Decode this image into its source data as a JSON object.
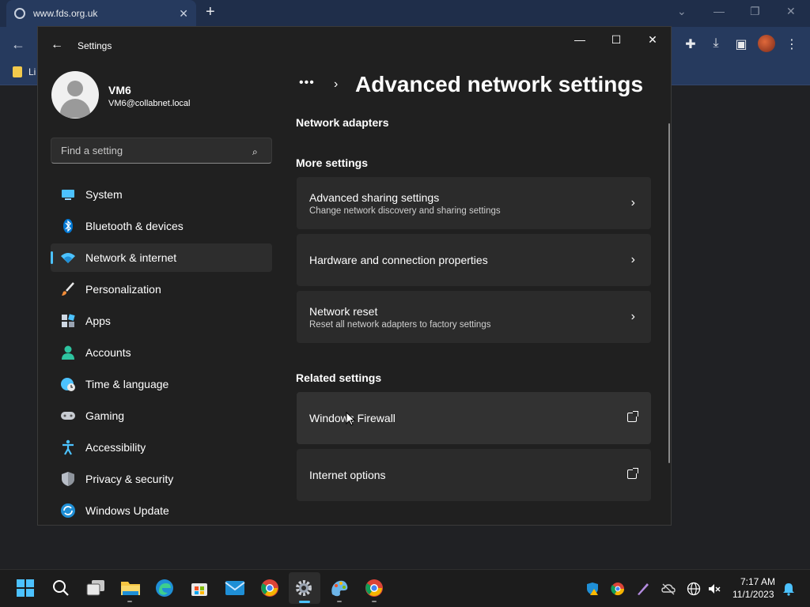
{
  "browser": {
    "tab_title": "www.fds.org.uk",
    "bookmark_label": "Li"
  },
  "window": {
    "title": "Settings"
  },
  "profile": {
    "name": "VM6",
    "email": "VM6@collabnet.local"
  },
  "search": {
    "placeholder": "Find a setting"
  },
  "nav": {
    "items": [
      {
        "label": "System",
        "icon": "monitor-icon"
      },
      {
        "label": "Bluetooth & devices",
        "icon": "bluetooth-icon"
      },
      {
        "label": "Network & internet",
        "icon": "wifi-icon"
      },
      {
        "label": "Personalization",
        "icon": "brush-icon"
      },
      {
        "label": "Apps",
        "icon": "apps-icon"
      },
      {
        "label": "Accounts",
        "icon": "person-icon"
      },
      {
        "label": "Time & language",
        "icon": "globe-clock-icon"
      },
      {
        "label": "Gaming",
        "icon": "gamepad-icon"
      },
      {
        "label": "Accessibility",
        "icon": "accessibility-icon"
      },
      {
        "label": "Privacy & security",
        "icon": "shield-icon"
      },
      {
        "label": "Windows Update",
        "icon": "update-icon"
      }
    ],
    "active_index": 2
  },
  "page": {
    "breadcrumb_more": "•••",
    "title": "Advanced network settings"
  },
  "sections": {
    "adapters": "Network adapters",
    "more": "More settings",
    "related": "Related settings"
  },
  "more_settings": [
    {
      "title": "Advanced sharing settings",
      "desc": "Change network discovery and sharing settings"
    },
    {
      "title": "Hardware and connection properties",
      "desc": ""
    },
    {
      "title": "Network reset",
      "desc": "Reset all network adapters to factory settings"
    }
  ],
  "related_settings": [
    {
      "title": "Windows Firewall"
    },
    {
      "title": "Internet options"
    }
  ],
  "taskbar": {
    "time": "7:17 AM",
    "date": "11/1/2023"
  }
}
